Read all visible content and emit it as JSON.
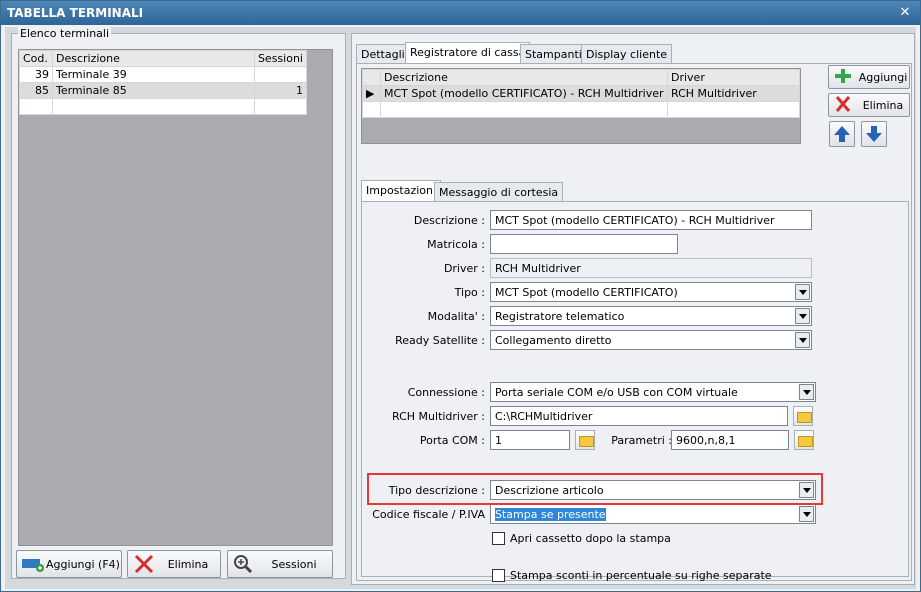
{
  "window": {
    "title": "TABELLA TERMINALI",
    "close": "✕"
  },
  "left": {
    "group_label": "Elenco terminali",
    "columns": [
      "Cod.",
      "Descrizione",
      "Sessioni"
    ],
    "rows": [
      {
        "cod": "39",
        "descrizione": "Terminale 39",
        "sessioni": ""
      },
      {
        "cod": "85",
        "descrizione": "Terminale 85",
        "sessioni": "1"
      }
    ],
    "buttons": {
      "add": "Aggiungi (F4)",
      "delete": "Elimina",
      "sessions": "Sessioni"
    }
  },
  "tabs": [
    "Dettagli",
    "Registratore di cassa",
    "Stampanti",
    "Display cliente"
  ],
  "register": {
    "columns": [
      "Descrizione",
      "Driver"
    ],
    "rows": [
      {
        "descrizione": "MCT Spot (modello CERTIFICATO) - RCH Multidriver",
        "driver": "RCH Multidriver"
      }
    ],
    "row_marker": "▶",
    "buttons": {
      "add": "Aggiungi",
      "delete": "Elimina"
    }
  },
  "subtabs": [
    "Impostazioni",
    "Messaggio di cortesia"
  ],
  "form": {
    "descrizione_label": "Descrizione :",
    "descrizione": "MCT Spot (modello CERTIFICATO) - RCH Multidriver",
    "matricola_label": "Matricola :",
    "matricola": "",
    "driver_label": "Driver :",
    "driver": "RCH Multidriver",
    "tipo_label": "Tipo :",
    "tipo": "MCT Spot (modello CERTIFICATO)",
    "modalita_label": "Modalita' :",
    "modalita": "Registratore telematico",
    "ready_label": "Ready Satellite :",
    "ready": "Collegamento diretto",
    "connessione_label": "Connessione :",
    "connessione": "Porta seriale COM e/o USB con COM virtuale",
    "rch_label": "RCH Multidriver :",
    "rch": "C:\\RCHMultidriver",
    "porta_label": "Porta COM :",
    "porta": "1",
    "parametri_label": "Parametri :",
    "parametri": "9600,n,8,1",
    "tipo_desc_label": "Tipo descrizione :",
    "tipo_desc": "Descrizione articolo",
    "codice_label": "Codice fiscale / P.IVA",
    "codice": "Stampa se presente",
    "cassetto": "Apri cassetto dopo la stampa",
    "sconti": "Stampa sconti in percentuale su righe separate"
  }
}
